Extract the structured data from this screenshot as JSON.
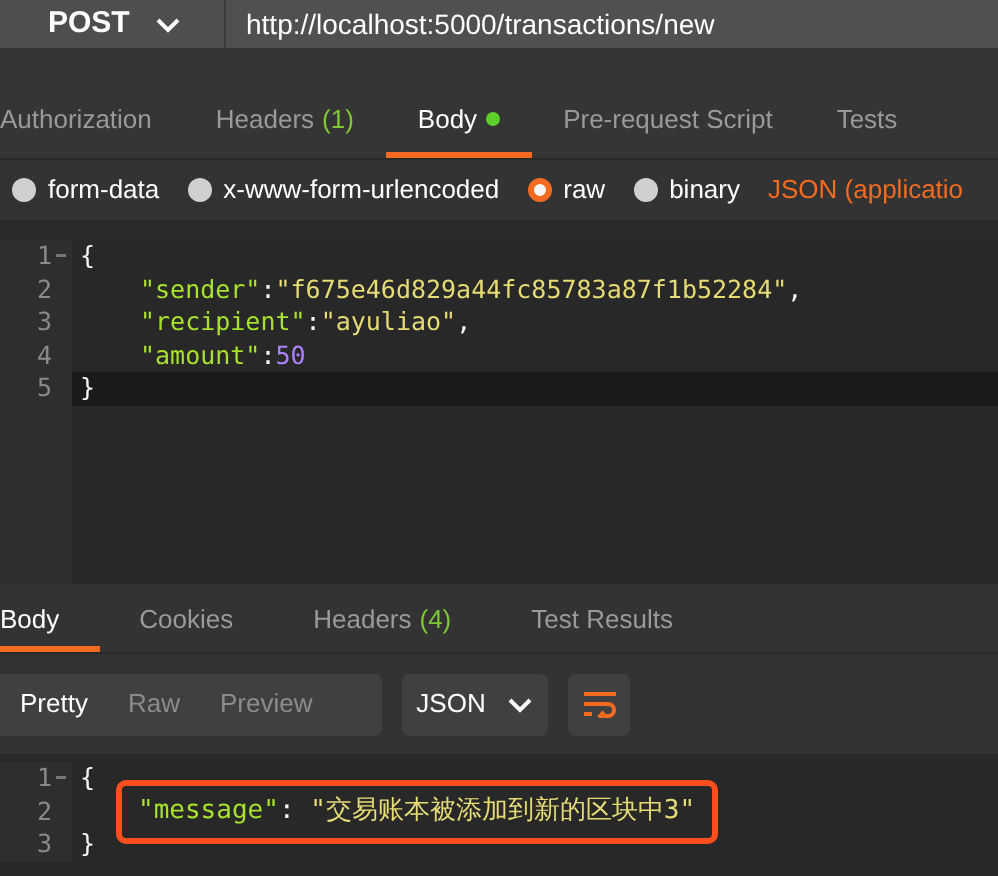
{
  "request": {
    "method": "POST",
    "url": "http://localhost:5000/transactions/new"
  },
  "request_tabs": [
    {
      "label": "Authorization",
      "dot": false,
      "selected": false
    },
    {
      "label": "Headers",
      "count": "(1)",
      "dot": false,
      "selected": false
    },
    {
      "label": "Body",
      "dot": true,
      "selected": true
    },
    {
      "label": "Pre-request Script",
      "dot": false,
      "selected": false
    },
    {
      "label": "Tests",
      "dot": false,
      "selected": false
    }
  ],
  "body_types": [
    {
      "label": "form-data",
      "selected": false
    },
    {
      "label": "x-www-form-urlencoded",
      "selected": false
    },
    {
      "label": "raw",
      "selected": true
    },
    {
      "label": "binary",
      "selected": false
    }
  ],
  "body_format": "JSON (applicatio",
  "request_body": [
    {
      "number": "1",
      "fold": true,
      "current": false,
      "tokens": [
        {
          "kind": "punct",
          "text": "{"
        }
      ]
    },
    {
      "number": "2",
      "fold": false,
      "current": false,
      "tokens": [
        {
          "kind": "key",
          "text": "\"sender\""
        },
        {
          "kind": "punct",
          "text": ":"
        },
        {
          "kind": "string",
          "text": "\"f675e46d829a44fc85783a87f1b52284\""
        },
        {
          "kind": "punct",
          "text": ","
        }
      ]
    },
    {
      "number": "3",
      "fold": false,
      "current": false,
      "tokens": [
        {
          "kind": "key",
          "text": "\"recipient\""
        },
        {
          "kind": "punct",
          "text": ":"
        },
        {
          "kind": "string",
          "text": "\"ayuliao\""
        },
        {
          "kind": "punct",
          "text": ","
        }
      ]
    },
    {
      "number": "4",
      "fold": false,
      "current": false,
      "tokens": [
        {
          "kind": "key",
          "text": "\"amount\""
        },
        {
          "kind": "punct",
          "text": ":"
        },
        {
          "kind": "number",
          "text": "50"
        }
      ]
    },
    {
      "number": "5",
      "fold": false,
      "current": true,
      "tokens": [
        {
          "kind": "punct",
          "text": "}"
        }
      ]
    }
  ],
  "response_tabs": [
    {
      "label": "Body",
      "selected": true
    },
    {
      "label": "Cookies",
      "selected": false
    },
    {
      "label": "Headers",
      "count": "(4)",
      "selected": false
    },
    {
      "label": "Test Results",
      "selected": false
    }
  ],
  "view_modes": [
    {
      "label": "Pretty",
      "selected": true
    },
    {
      "label": "Raw",
      "selected": false
    },
    {
      "label": "Preview",
      "selected": false
    }
  ],
  "response_format": "JSON",
  "response_body": [
    {
      "number": "1",
      "fold": true,
      "highlighted": false,
      "tokens": [
        {
          "kind": "punct",
          "text": "{"
        }
      ]
    },
    {
      "number": "2",
      "fold": false,
      "highlighted": true,
      "tokens": [
        {
          "kind": "key",
          "text": "\"message\""
        },
        {
          "kind": "punct",
          "text": ": "
        },
        {
          "kind": "string",
          "text": "\"交易账本被添加到新的区块中3\""
        }
      ]
    },
    {
      "number": "3",
      "fold": false,
      "highlighted": false,
      "tokens": [
        {
          "kind": "punct",
          "text": "}"
        }
      ]
    }
  ]
}
